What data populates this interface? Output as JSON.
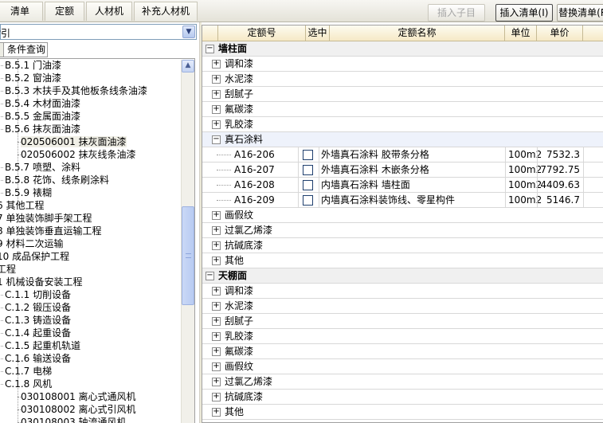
{
  "toolbar": {
    "tabs": [
      "清单",
      "定额",
      "人材机",
      "补充人材机"
    ],
    "insert_sub_label": "插入子目",
    "insert_list_label": "插入清单(I)",
    "replace_list_label": "替换清单(R)"
  },
  "left": {
    "combo_value": "指引",
    "subtabs": [
      "",
      "条件查询"
    ],
    "tree": [
      {
        "code": "B.5.1",
        "label": "门油漆"
      },
      {
        "code": "B.5.2",
        "label": "窗油漆"
      },
      {
        "code": "B.5.3",
        "label": "木扶手及其他板条线条油漆"
      },
      {
        "code": "B.5.4",
        "label": "木材面油漆"
      },
      {
        "code": "B.5.5",
        "label": "金属面油漆"
      },
      {
        "code": "B.5.6",
        "label": "抹灰面油漆"
      },
      {
        "code": "020506001",
        "label": "抹灰面油漆"
      },
      {
        "code": "020506002",
        "label": "抹灰线条油漆"
      },
      {
        "code": "B.5.7",
        "label": "喷塑、涂料"
      },
      {
        "code": "B.5.8",
        "label": "花饰、线条刷涂料"
      },
      {
        "code": "B.5.9",
        "label": "裱糊"
      },
      {
        "code": "6",
        "label": "其他工程"
      },
      {
        "code": "7",
        "label": "单独装饰脚手架工程"
      },
      {
        "code": "8",
        "label": "单独装饰垂直运输工程"
      },
      {
        "code": "9",
        "label": "材料二次运输"
      },
      {
        "code": "10",
        "label": "成品保护工程"
      },
      {
        "code": "",
        "label": "工程"
      },
      {
        "code": "1",
        "label": "机械设备安装工程"
      },
      {
        "code": "C.1.1",
        "label": "切削设备"
      },
      {
        "code": "C.1.2",
        "label": "锻压设备"
      },
      {
        "code": "C.1.3",
        "label": "铸造设备"
      },
      {
        "code": "C.1.4",
        "label": "起重设备"
      },
      {
        "code": "C.1.5",
        "label": "起重机轨道"
      },
      {
        "code": "C.1.6",
        "label": "输送设备"
      },
      {
        "code": "C.1.7",
        "label": "电梯"
      },
      {
        "code": "C.1.8",
        "label": "风机"
      },
      {
        "code": "030108001",
        "label": "离心式通风机"
      },
      {
        "code": "030108002",
        "label": "离心式引风机"
      },
      {
        "code": "030108003",
        "label": "轴流通风机"
      }
    ]
  },
  "grid": {
    "columns": [
      "",
      "定额号",
      "选中",
      "定额名称",
      "单位",
      "单价"
    ],
    "rows": [
      {
        "type": "group",
        "text": "墙柱面"
      },
      {
        "type": "sub",
        "text": "调和漆"
      },
      {
        "type": "sub",
        "text": "水泥漆"
      },
      {
        "type": "sub",
        "text": "刮腻子"
      },
      {
        "type": "sub",
        "text": "氟碳漆"
      },
      {
        "type": "sub",
        "text": "乳胶漆"
      },
      {
        "type": "subopen",
        "text": "真石涂料"
      },
      {
        "type": "item",
        "code": "A16-206",
        "name": "外墙真石涂料  胶带条分格",
        "unit": "100m2",
        "price": "7532.3"
      },
      {
        "type": "item",
        "code": "A16-207",
        "name": "外墙真石涂料  木嵌条分格",
        "unit": "100m2",
        "price": "7792.75"
      },
      {
        "type": "item",
        "code": "A16-208",
        "name": "内墙真石涂料  墙柱面",
        "unit": "100m2",
        "price": "4409.63"
      },
      {
        "type": "item",
        "code": "A16-209",
        "name": "内墙真石涂料装饰线、零星构件",
        "unit": "100m2",
        "price": "5146.7"
      },
      {
        "type": "sub",
        "text": "画假纹"
      },
      {
        "type": "sub",
        "text": "过氯乙烯漆"
      },
      {
        "type": "sub",
        "text": "抗碱底漆"
      },
      {
        "type": "sub",
        "text": "其他"
      },
      {
        "type": "group",
        "text": "天棚面"
      },
      {
        "type": "sub",
        "text": "调和漆"
      },
      {
        "type": "sub",
        "text": "水泥漆"
      },
      {
        "type": "sub",
        "text": "刮腻子"
      },
      {
        "type": "sub",
        "text": "乳胶漆"
      },
      {
        "type": "sub",
        "text": "氟碳漆"
      },
      {
        "type": "sub",
        "text": "画假纹"
      },
      {
        "type": "sub",
        "text": "过氯乙烯漆"
      },
      {
        "type": "sub",
        "text": "抗碱底漆"
      },
      {
        "type": "sub",
        "text": "其他"
      }
    ]
  }
}
